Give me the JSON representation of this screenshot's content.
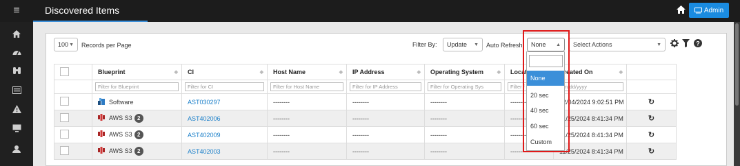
{
  "header": {
    "title": "Discovered Items",
    "admin_label": "Admin"
  },
  "toolbar": {
    "records_per_page_value": "100",
    "records_per_page_label": "Records per Page",
    "filter_by_label": "Filter By:",
    "filter_by_value": "Update",
    "auto_refresh_label": "Auto Refresh",
    "auto_refresh_value": "None",
    "select_actions_placeholder": "Select Actions"
  },
  "table": {
    "columns": [
      "Blueprint",
      "CI",
      "Host Name",
      "IP Address",
      "Operating System",
      "Locatio",
      "Created On"
    ],
    "filters": [
      "Filter for Blueprint",
      "Filter for CI",
      "Filter for Host Name",
      "Filter for IP Address",
      "Filter for Operating Sys",
      "Filter f",
      "mm/dd/yyyy"
    ],
    "rows": [
      {
        "blueprint": "Software",
        "badge": "",
        "ci": "AST030297",
        "host": "--------",
        "ip": "--------",
        "os": "--------",
        "location": "--------",
        "created": "12/04/2024 9:02:51 PM",
        "icon": "software-icon"
      },
      {
        "blueprint": "AWS S3",
        "badge": "2",
        "ci": "AST402006",
        "host": "--------",
        "ip": "--------",
        "os": "--------",
        "location": "--------",
        "created": "11/25/2024 8:41:34 PM",
        "icon": "aws-s3-icon"
      },
      {
        "blueprint": "AWS S3",
        "badge": "2",
        "ci": "AST402009",
        "host": "--------",
        "ip": "--------",
        "os": "--------",
        "location": "--------",
        "created": "11/25/2024 8:41:34 PM",
        "icon": "aws-s3-icon"
      },
      {
        "blueprint": "AWS S3",
        "badge": "2",
        "ci": "AST402003",
        "host": "--------",
        "ip": "--------",
        "os": "--------",
        "location": "--------",
        "created": "11/25/2024 8:41:34 PM",
        "icon": "aws-s3-icon"
      }
    ]
  },
  "refresh_dropdown": {
    "options": [
      "None",
      "20 sec",
      "40 sec",
      "60 sec",
      "Custom"
    ],
    "selected": "None"
  },
  "colors": {
    "accent": "#1a8be0",
    "highlight": "#e01818",
    "link": "#1a7fc9"
  }
}
